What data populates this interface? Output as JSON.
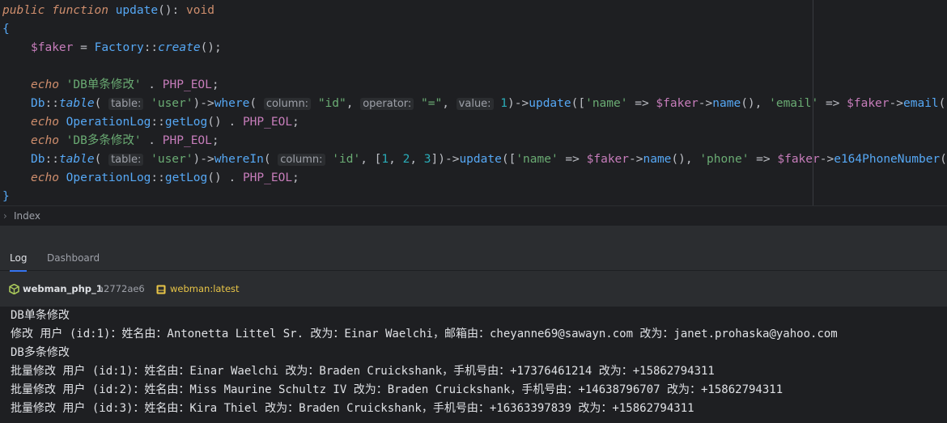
{
  "code": {
    "l1": {
      "kw1": "public",
      "kw2": "function",
      "name": "update",
      "rest": "(): ",
      "ret": "void"
    },
    "l2": "{",
    "l3": {
      "var": "$faker",
      "eq": " = ",
      "cls": "Factory",
      "sep": "::",
      "fn": "create",
      "end": "();"
    },
    "l5": {
      "kw": "echo",
      "str": "'DB单条修改'",
      "dot": " . ",
      "const": "PHP_EOL",
      "end": ";"
    },
    "l6": {
      "cls": "Db",
      "sep": "::",
      "fn": "table",
      "p1": "( ",
      "h1": "table:",
      "s1": "'user'",
      "arrow1": ")->",
      "fn2": "where",
      "p2": "( ",
      "h2": "column:",
      "s2": "\"id\"",
      "c1": ", ",
      "h3": "operator:",
      "s3": "\"=\"",
      "c2": ", ",
      "h4": "value:",
      "n1": "1",
      "arrow2": ")->",
      "fn3": "update",
      "b1": "([",
      "s4": "'name'",
      "fa1": " => ",
      "v1": "$faker",
      "arrow3": "->",
      "fn4": "name",
      "pc1": "(), ",
      "s5": "'email'",
      "fa2": " => ",
      "v2": "$faker",
      "arrow4": "->",
      "fn5": "email",
      "end": "()]);"
    },
    "l7": {
      "kw": "echo",
      "cls": "OperationLog",
      "sep": "::",
      "fn": "getLog",
      "mid": "() . ",
      "const": "PHP_EOL",
      "end": ";"
    },
    "l8": {
      "kw": "echo",
      "str": "'DB多条修改'",
      "dot": " . ",
      "const": "PHP_EOL",
      "end": ";"
    },
    "l9": {
      "cls": "Db",
      "sep": "::",
      "fn": "table",
      "p1": "( ",
      "h1": "table:",
      "s1": "'user'",
      "arrow1": ")->",
      "fn2": "whereIn",
      "p2": "( ",
      "h2": "column:",
      "s2": "'id'",
      "c1": ", [",
      "n1": "1",
      "c2": ", ",
      "n2": "2",
      "c3": ", ",
      "n3": "3",
      "arrow2": "])->",
      "fn3": "update",
      "b1": "([",
      "s3": "'name'",
      "fa1": " => ",
      "v1": "$faker",
      "arrow3": "->",
      "fn4": "name",
      "pc1": "(), ",
      "s4": "'phone'",
      "fa2": " => ",
      "v2": "$faker",
      "arrow4": "->",
      "fn5": "e164PhoneNumber",
      "end": "()]);"
    },
    "l10": {
      "kw": "echo",
      "cls": "OperationLog",
      "sep": "::",
      "fn": "getLog",
      "mid": "() . ",
      "const": "PHP_EOL",
      "end": ";"
    },
    "l11": "}"
  },
  "breadcrumb": {
    "chevron": "›",
    "label": "Index"
  },
  "tabs": {
    "log": "Log",
    "dashboard": "Dashboard"
  },
  "container": {
    "name": "webman_php_1",
    "id": "a2772ae6",
    "image": "webman:latest"
  },
  "terminal": [
    "DB单条修改",
    "修改 用户 (id:1)：姓名由：Antonetta Littel Sr. 改为：Einar Waelchi，邮箱由：cheyanne69@sawayn.com 改为：janet.prohaska@yahoo.com",
    "DB多条修改",
    "批量修改 用户 (id:1)：姓名由：Einar Waelchi 改为：Braden Cruickshank，手机号由：+17376461214 改为：+15862794311",
    "批量修改 用户 (id:2)：姓名由：Miss Maurine Schultz IV 改为：Braden Cruickshank，手机号由：+14638796707 改为：+15862794311",
    "批量修改 用户 (id:3)：姓名由：Kira Thiel 改为：Braden Cruickshank，手机号由：+16363397839 改为：+15862794311"
  ],
  "colors": {
    "accent": "#3574f0",
    "container_icon": "#a8c65a",
    "image_icon": "#e8c547"
  }
}
